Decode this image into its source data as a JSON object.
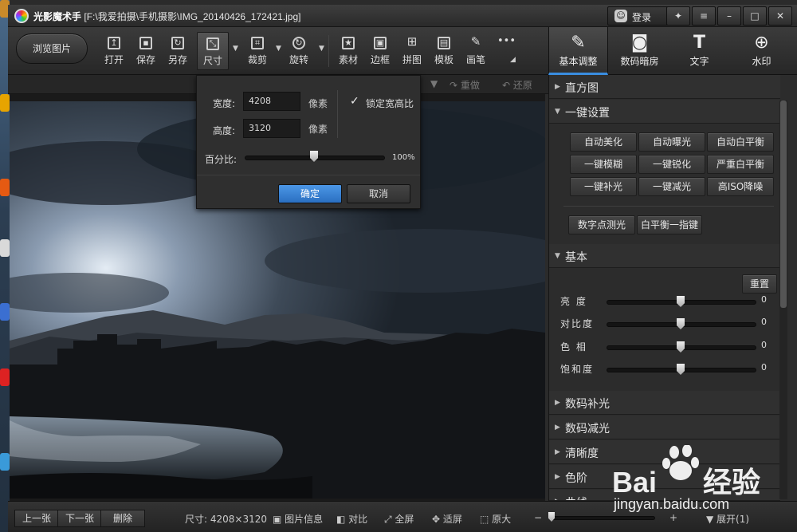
{
  "window": {
    "app_name": "光影魔术手",
    "file_path": "[F:\\我爱拍摄\\手机摄影\\IMG_20140426_172421.jpg]",
    "login_label": "登录",
    "buttons": [
      "skin-icon",
      "menu-icon",
      "minimize",
      "maximize",
      "close"
    ]
  },
  "toolbar": {
    "browse_label": "浏览图片",
    "tools": [
      {
        "label": "打开",
        "icon": "open-icon"
      },
      {
        "label": "保存",
        "icon": "save-icon"
      },
      {
        "label": "另存",
        "icon": "save-as-icon"
      },
      {
        "label": "尺寸",
        "icon": "resize-icon"
      },
      {
        "label": "裁剪",
        "icon": "crop-icon"
      },
      {
        "label": "旋转",
        "icon": "rotate-icon"
      },
      {
        "label": "素材",
        "icon": "material-icon"
      },
      {
        "label": "边框",
        "icon": "border-icon"
      },
      {
        "label": "拼图",
        "icon": "collage-icon"
      },
      {
        "label": "模板",
        "icon": "template-icon"
      },
      {
        "label": "画笔",
        "icon": "brush-icon"
      },
      {
        "label": "",
        "icon": "more-icon"
      }
    ],
    "right_tabs": [
      {
        "label": "基本调整",
        "icon": "edit-icon"
      },
      {
        "label": "数码暗房",
        "icon": "camera-icon"
      },
      {
        "label": "文字",
        "icon": "text-icon"
      },
      {
        "label": "水印",
        "icon": "watermark-icon"
      }
    ]
  },
  "subbar": {
    "redo_label": "重做",
    "restore_label": "还原"
  },
  "resize_dialog": {
    "width_label": "宽度:",
    "width_value": "4208",
    "height_label": "高度:",
    "height_value": "3120",
    "unit": "像素",
    "lock_ratio_label": "锁定宽高比",
    "lock_ratio_checked": true,
    "percent_label": "百分比:",
    "percent_value": "100%",
    "percent_level": 0.5,
    "ok_label": "确定",
    "cancel_label": "取消"
  },
  "right_panel": {
    "histogram_label": "直方图",
    "oneclick_label": "一键设置",
    "oneclick_buttons": [
      "自动美化",
      "自动曝光",
      "自动白平衡",
      "一键模糊",
      "一键锐化",
      "严重白平衡",
      "一键补光",
      "一键减光",
      "高ISO降噪"
    ],
    "extra_buttons": [
      "数字点测光",
      "白平衡一指键"
    ],
    "basic_label": "基本",
    "reset_label": "重置",
    "sliders": [
      {
        "label": "亮  度",
        "value": "0"
      },
      {
        "label": "对比度",
        "value": "0"
      },
      {
        "label": "色  相",
        "value": "0"
      },
      {
        "label": "饱和度",
        "value": "0"
      }
    ],
    "more_sections": [
      "数码补光",
      "数码减光",
      "清晰度",
      "色阶",
      "曲线"
    ]
  },
  "bottombar": {
    "prev_label": "上一张",
    "next_label": "下一张",
    "delete_label": "删除",
    "size_text": "尺寸: 4208×3120",
    "info_label": "图片信息",
    "compare_label": "对比",
    "fullscreen_label": "全屏",
    "fit_label": "适屏",
    "original_label": "原大",
    "expand_label": "展开(1)"
  },
  "watermark": {
    "brand": "Bai",
    "brand2": "经验",
    "url": "jingyan.baidu.com"
  }
}
